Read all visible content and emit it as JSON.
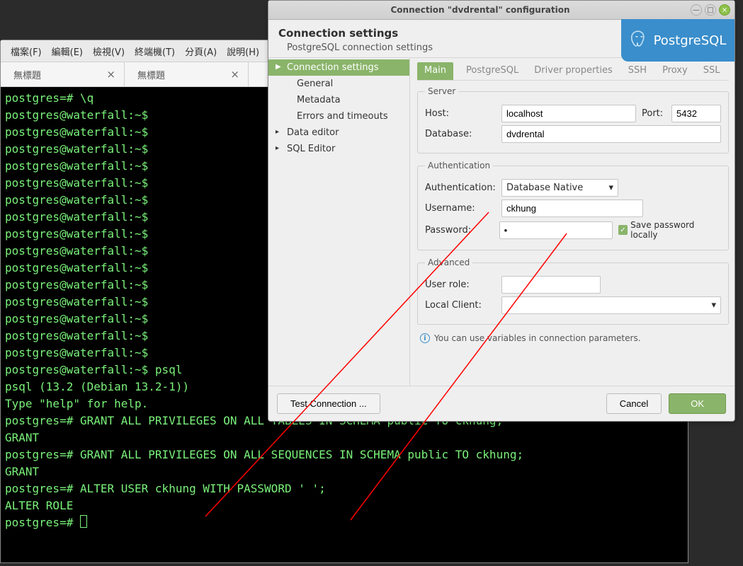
{
  "terminal": {
    "menu": [
      "檔案(F)",
      "編輯(E)",
      "檢視(V)",
      "終端機(T)",
      "分頁(A)",
      "說明(H)"
    ],
    "tabs": [
      {
        "title": "無標題",
        "close": "×"
      },
      {
        "title": "無標題",
        "close": "×"
      }
    ],
    "lines": [
      "postgres=# \\q",
      "postgres@waterfall:~$",
      "postgres@waterfall:~$",
      "postgres@waterfall:~$",
      "postgres@waterfall:~$",
      "postgres@waterfall:~$",
      "postgres@waterfall:~$",
      "postgres@waterfall:~$",
      "postgres@waterfall:~$",
      "postgres@waterfall:~$",
      "postgres@waterfall:~$",
      "postgres@waterfall:~$",
      "postgres@waterfall:~$",
      "postgres@waterfall:~$",
      "postgres@waterfall:~$",
      "postgres@waterfall:~$",
      "postgres@waterfall:~$ psql",
      "psql (13.2 (Debian 13.2-1))",
      "Type \"help\" for help.",
      "",
      "postgres=# GRANT ALL PRIVILEGES ON ALL TABLES IN SCHEMA public TO ckhung;",
      "GRANT",
      "postgres=# GRANT ALL PRIVILEGES ON ALL SEQUENCES IN SCHEMA public TO ckhung;",
      "GRANT",
      "postgres=# ALTER USER ckhung WITH PASSWORD ' ';",
      "ALTER ROLE",
      "postgres=# "
    ]
  },
  "dialog": {
    "title": "Connection \"dvdrental\" configuration",
    "header": "Connection settings",
    "subheader": "PostgreSQL connection settings",
    "logo_text": "PostgreSQL",
    "side": {
      "items": [
        {
          "label": "Connection settings",
          "sel": true,
          "arrow": "▶"
        },
        {
          "label": "General",
          "sub": true
        },
        {
          "label": "Metadata",
          "sub": true
        },
        {
          "label": "Errors and timeouts",
          "sub": true
        },
        {
          "label": "Data editor",
          "arrow": "▸"
        },
        {
          "label": "SQL Editor",
          "arrow": "▸"
        }
      ]
    },
    "tabs": [
      "Main",
      "PostgreSQL",
      "Driver properties",
      "SSH",
      "Proxy",
      "SSL"
    ],
    "server": {
      "legend": "Server",
      "host_label": "Host:",
      "host": "localhost",
      "port_label": "Port:",
      "port": "5432",
      "db_label": "Database:",
      "db": "dvdrental"
    },
    "auth": {
      "legend": "Authentication",
      "auth_label": "Authentication:",
      "auth_value": "Database Native",
      "user_label": "Username:",
      "user": "ckhung",
      "pass_label": "Password:",
      "pass": "•",
      "save_pass": "Save password locally"
    },
    "advanced": {
      "legend": "Advanced",
      "role_label": "User role:",
      "role": "",
      "client_label": "Local Client:",
      "client": ""
    },
    "info": "You can use variables in connection parameters.",
    "buttons": {
      "test": "Test Connection ...",
      "cancel": "Cancel",
      "ok": "OK"
    },
    "winctrl": {
      "min": "—",
      "max": "□",
      "close": "×"
    }
  }
}
